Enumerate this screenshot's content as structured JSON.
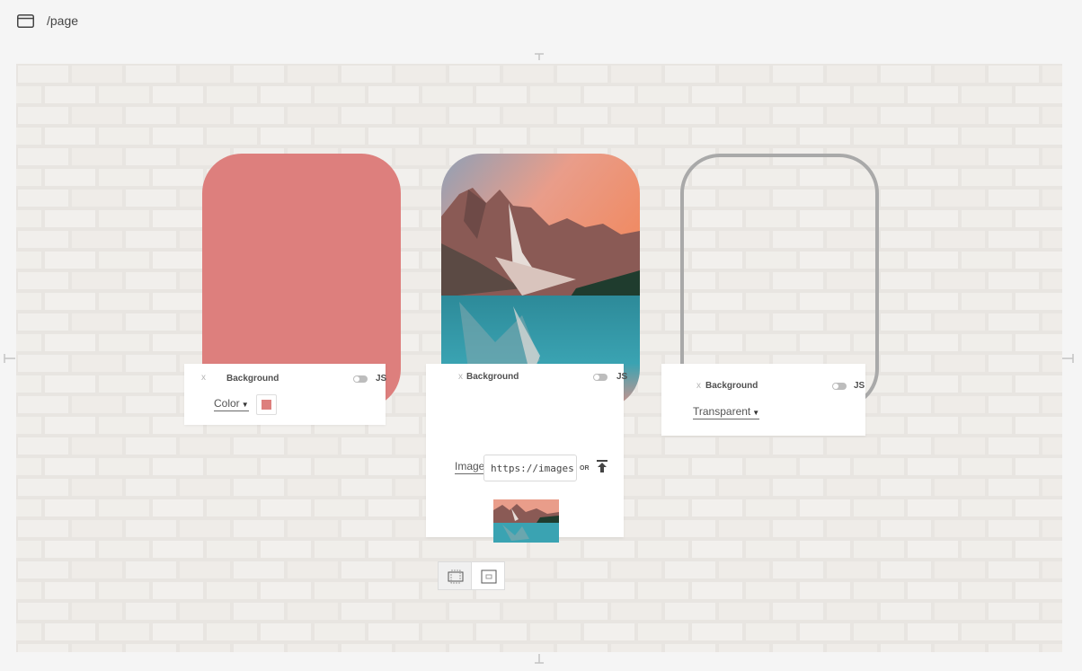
{
  "topbar": {
    "path": "/page",
    "icon": "browser-window-icon"
  },
  "colors": {
    "card_color": "#dd7f7d",
    "transparent_border": "#a9a9a9",
    "panel_bg": "#ffffff",
    "page_bg": "#f5f5f5"
  },
  "cards": [
    {
      "type": "color",
      "background": "#dd7f7d"
    },
    {
      "type": "image",
      "image": "mountain-lake-photo"
    },
    {
      "type": "transparent"
    }
  ],
  "panels": [
    {
      "title": "Background",
      "close": "x",
      "js_label": "JS",
      "mode": "Color",
      "swatch_color": "#dd7f7d"
    },
    {
      "title": "Background",
      "close": "x",
      "js_label": "JS",
      "mode": "Image",
      "url_value": "https://images.",
      "or_label": "OR",
      "upload_icon": "upload-icon",
      "size_buttons": [
        "cover-icon",
        "contain-icon"
      ]
    },
    {
      "title": "Background",
      "close": "x",
      "js_label": "JS",
      "mode": "Transparent"
    }
  ]
}
